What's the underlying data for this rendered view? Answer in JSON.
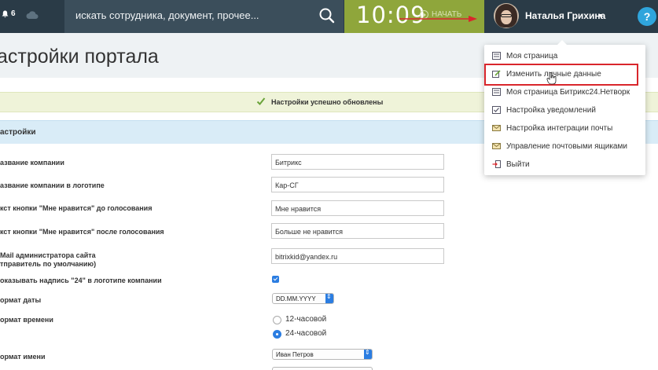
{
  "topbar": {
    "notifications_count": "6",
    "search_placeholder": "искать сотрудника, документ, прочее...",
    "clock": "10:09",
    "start_label": "НАЧАТЬ",
    "user_name": "Наталья Грихина",
    "help_label": "?"
  },
  "page": {
    "title": "астройки портала",
    "success_message": "Настройки успешно обновлены",
    "section_title": "астройки"
  },
  "form": {
    "company_name_label": "азвание компании",
    "company_name_value": "Битрикс",
    "logo_name_label": "азвание компании в логотипе",
    "logo_name_value": "Кар-СГ",
    "like_before_label": "кст кнопки \"Мне нравится\" до голосования",
    "like_before_value": "Мне нравится",
    "like_after_label": "кст кнопки \"Мне нравится\" после голосования",
    "like_after_value": "Больше не нравится",
    "admin_email_label_1": "Mail администратора сайта",
    "admin_email_label_2": "тправитель по умолчанию)",
    "admin_email_value": "bitrixkid@yandex.ru",
    "show24_label": "оказывать надпись \"24\" в логотипе компании",
    "date_format_label": "ормат даты",
    "date_format_value": "DD.MM.YYYY",
    "time_format_label": "ормат времени",
    "time_option_12": "12-часовой",
    "time_option_24": "24-часовой",
    "name_format_label": "ормат имени",
    "name_format_value": "Иван Петров"
  },
  "user_menu": {
    "items": [
      {
        "label": "Моя страница"
      },
      {
        "label": "Изменить личные данные"
      },
      {
        "label": "Моя страница Битрикс24.Нетворк"
      },
      {
        "label": "Настройка уведомлений"
      },
      {
        "label": "Настройка интеграции почты"
      },
      {
        "label": "Управление почтовыми ящиками"
      },
      {
        "label": "Выйти"
      }
    ]
  },
  "colors": {
    "topbar": "#2a3b47",
    "timer": "#8fa63b",
    "accent": "#2b7de1",
    "highlight": "#d9262c"
  }
}
